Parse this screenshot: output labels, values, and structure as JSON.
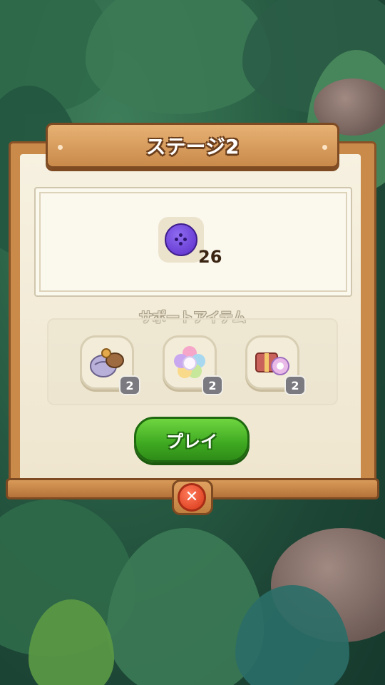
{
  "dialog": {
    "title": "ステージ2",
    "goal": {
      "icon": "purple-button-icon",
      "count": "26"
    },
    "support_label": "サポートアイテム",
    "items": [
      {
        "icon": "bomb-sack-icon",
        "count": "2"
      },
      {
        "icon": "rainbow-flower-icon",
        "count": "2"
      },
      {
        "icon": "gift-bundle-icon",
        "count": "2"
      }
    ],
    "play_label": "プレイ",
    "close_label": "✕"
  },
  "colors": {
    "wood": "#c98a4a",
    "paper": "#f7f1e1",
    "play_green": "#3ea821",
    "close_red": "#e24a2a",
    "goal_purple": "#6a3fd6"
  }
}
